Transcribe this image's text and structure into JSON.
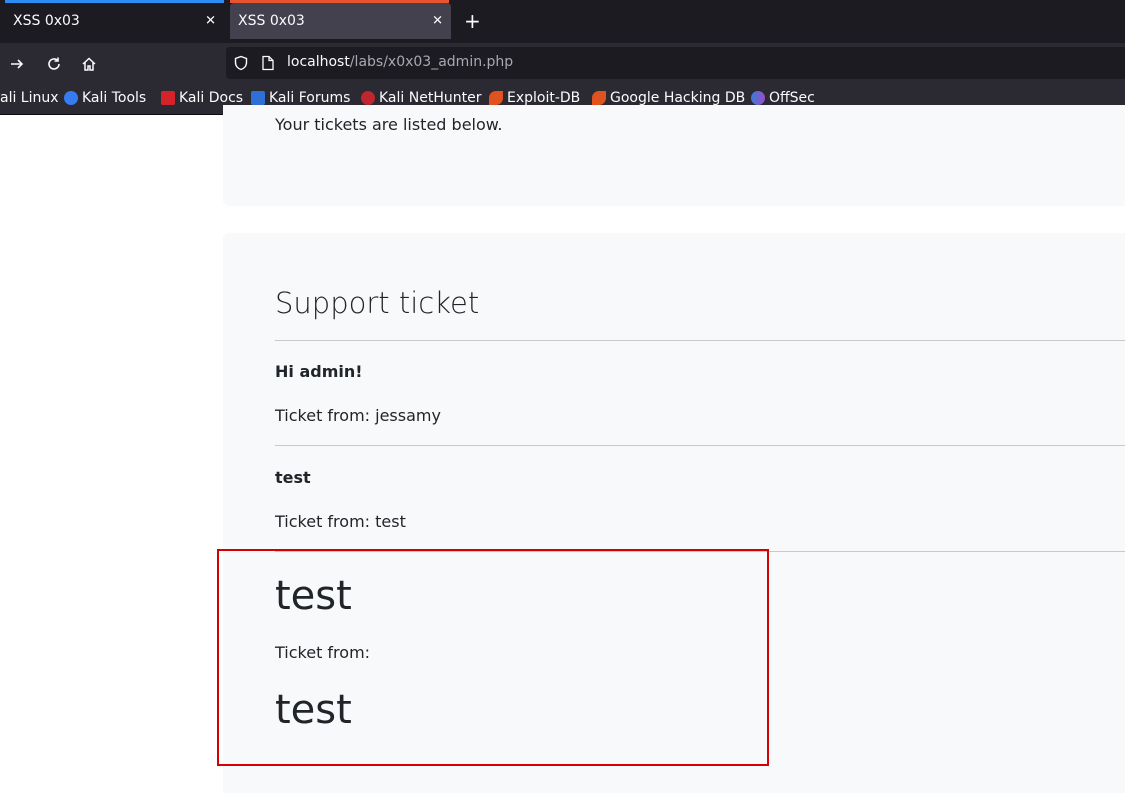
{
  "browser": {
    "tabs": [
      {
        "title": "XSS 0x03",
        "close": "✕"
      },
      {
        "title": "XSS 0x03",
        "close": "✕"
      }
    ],
    "new_tab": "+",
    "url": {
      "host": "localhost",
      "path": "/labs/x0x03_admin.php"
    },
    "bookmarks": [
      {
        "label": "ali Linux",
        "icon": "kali-icon"
      },
      {
        "label": "Kali Tools",
        "icon": "kali-tools-icon"
      },
      {
        "label": "Kali Docs",
        "icon": "kali-docs-icon"
      },
      {
        "label": "Kali Forums",
        "icon": "kali-forums-icon"
      },
      {
        "label": "Kali NetHunter",
        "icon": "kali-nethunter-icon"
      },
      {
        "label": "Exploit-DB",
        "icon": "exploit-db-icon"
      },
      {
        "label": "Google Hacking DB",
        "icon": "ghdb-icon"
      },
      {
        "label": "OffSec",
        "icon": "offsec-icon"
      }
    ]
  },
  "page": {
    "intro": "Your tickets are listed below.",
    "section_title": "Support ticket",
    "tickets": [
      {
        "subject": "Hi admin!",
        "from": "Ticket from: jessamy"
      },
      {
        "subject": "test",
        "from": "Ticket from: test"
      }
    ],
    "injected": {
      "heading_1": "test",
      "from": "Ticket from:",
      "heading_2": "test"
    }
  },
  "colors": {
    "tab_active_accent": "#2c8cf2",
    "tab_second_accent": "#e8542f",
    "highlight_border": "#d60000"
  }
}
